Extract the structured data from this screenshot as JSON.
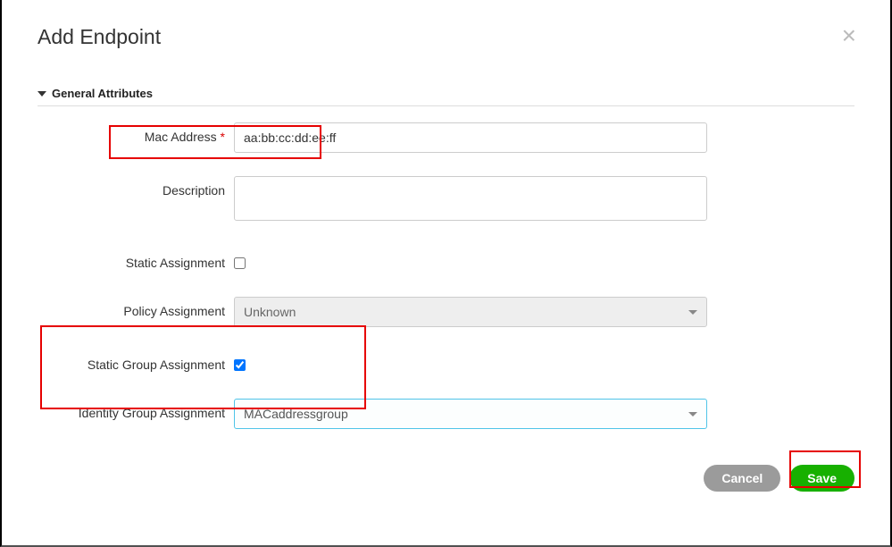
{
  "dialog": {
    "title": "Add Endpoint"
  },
  "section": {
    "title": "General Attributes"
  },
  "fields": {
    "macAddress": {
      "label": "Mac Address",
      "required": "*",
      "value": "aa:bb:cc:dd:ee:ff"
    },
    "description": {
      "label": "Description",
      "value": ""
    },
    "staticAssignment": {
      "label": "Static Assignment"
    },
    "policyAssignment": {
      "label": "Policy Assignment",
      "value": "Unknown"
    },
    "staticGroupAssignment": {
      "label": "Static Group Assignment"
    },
    "identityGroupAssignment": {
      "label": "Identity Group Assignment",
      "value": "MACaddressgroup"
    }
  },
  "buttons": {
    "cancel": "Cancel",
    "save": "Save"
  }
}
